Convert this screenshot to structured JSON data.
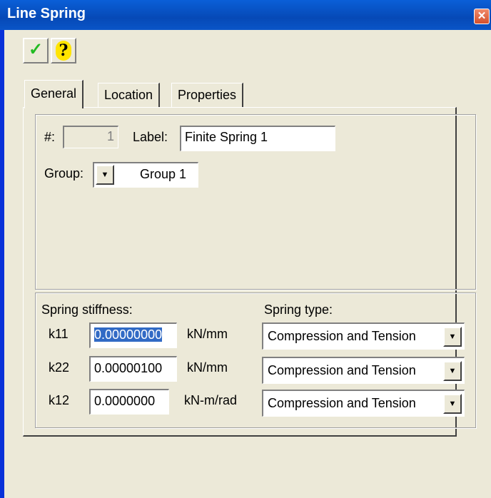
{
  "window": {
    "title": "Line Spring",
    "close_glyph": "✕"
  },
  "toolbar": {
    "ok_icon": "checkmark-icon",
    "ok_glyph": "✓",
    "help_icon": "help-icon",
    "help_glyph": "?"
  },
  "tabs": [
    {
      "label": "General",
      "active": true
    },
    {
      "label": "Location",
      "active": false
    },
    {
      "label": "Properties",
      "active": false
    }
  ],
  "general": {
    "number_label": "#:",
    "number_value": "1",
    "label_label": "Label:",
    "label_value": "Finite Spring 1",
    "group_label": "Group:",
    "group_value": "Group 1"
  },
  "spring": {
    "stiffness_heading": "Spring stiffness:",
    "type_heading": "Spring type:",
    "rows": [
      {
        "name": "k11",
        "value": "0.00000000",
        "unit": "kN/mm",
        "type": "Compression and Tension",
        "selected": true
      },
      {
        "name": "k22",
        "value": "0.00000100",
        "unit": "kN/mm",
        "type": "Compression and Tension",
        "selected": false
      },
      {
        "name": "k12",
        "value": "0.0000000",
        "unit": "kN-m/rad",
        "type": "Compression and Tension",
        "selected": false
      }
    ]
  },
  "colors": {
    "titlebar": "#0a5fd8",
    "face": "#ece9d8",
    "selection": "#316ac5"
  },
  "dropdown_glyph": "▼"
}
